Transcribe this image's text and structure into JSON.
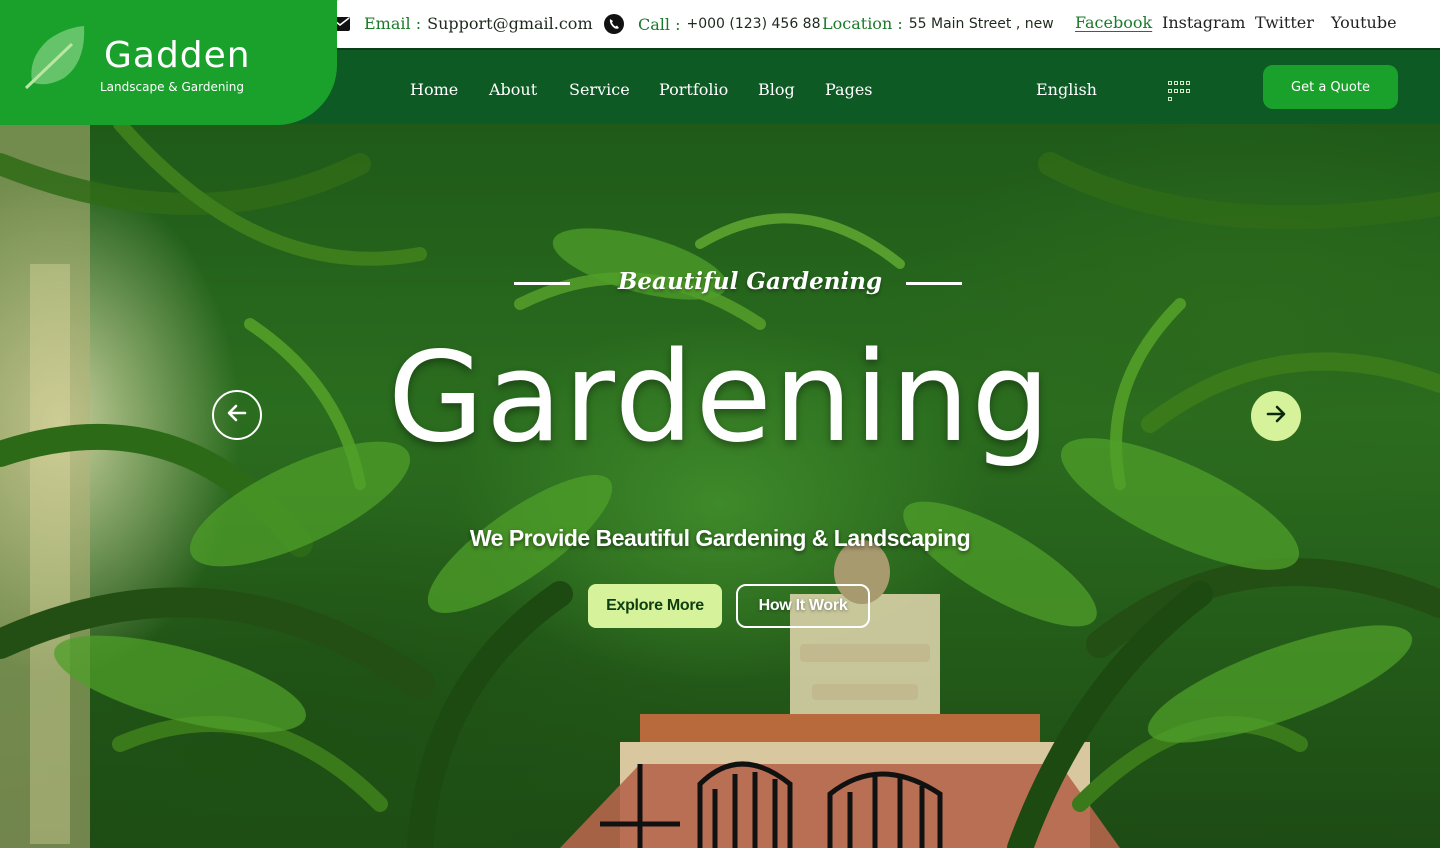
{
  "brand": {
    "name": "Gadden",
    "tagline": "Landscape & Gardening"
  },
  "contact": {
    "email_label": "Email :",
    "email": "Support@gmail.com",
    "call_label": "Call :",
    "phone": "+000 (123) 456 88",
    "location_label": "Location :",
    "location": "55 Main  Street , new"
  },
  "social": [
    "Facebook",
    "Instagram",
    "Twitter",
    "Youtube"
  ],
  "nav": [
    "Home",
    "About",
    "Service",
    "Portfolio",
    "Blog",
    "Pages"
  ],
  "language": "English",
  "cta": "Get a Quote",
  "hero": {
    "eyebrow": "Beautiful Gardening",
    "title": "Gardening",
    "tagline": "We Provide Beautiful Gardening & Landscaping",
    "primary_button": "Explore More",
    "secondary_button": "How It Work"
  },
  "colors": {
    "brand_green": "#1aa12c",
    "nav_green": "#0e5a25",
    "accent_lime": "#d6f29a"
  },
  "icons": [
    "leaf-logo-icon",
    "mail-icon",
    "phone-icon",
    "grid-menu-icon",
    "arrow-left-icon",
    "arrow-right-icon"
  ]
}
